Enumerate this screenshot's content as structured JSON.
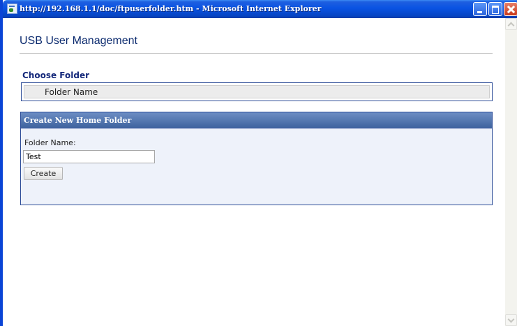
{
  "window": {
    "title": "http://192.168.1.1/doc/ftpuserfolder.htm - Microsoft Internet Explorer"
  },
  "page": {
    "title": "USB User Management"
  },
  "choose_folder": {
    "heading": "Choose Folder",
    "column_header": "Folder Name"
  },
  "create_panel": {
    "heading": "Create New Home Folder",
    "field_label": "Folder Name:",
    "field_value": "Test",
    "button_label": "Create"
  },
  "colors": {
    "title_text": "#0b2a6e",
    "section_heading": "#14287a",
    "panel_header": "#4a6aa5",
    "panel_border": "#2c4c97",
    "window_frame": "#0A53E2"
  },
  "icons": [
    "ie-page-icon",
    "minimize-icon",
    "maximize-icon",
    "close-icon",
    "scroll-up-icon",
    "scroll-down-icon"
  ]
}
